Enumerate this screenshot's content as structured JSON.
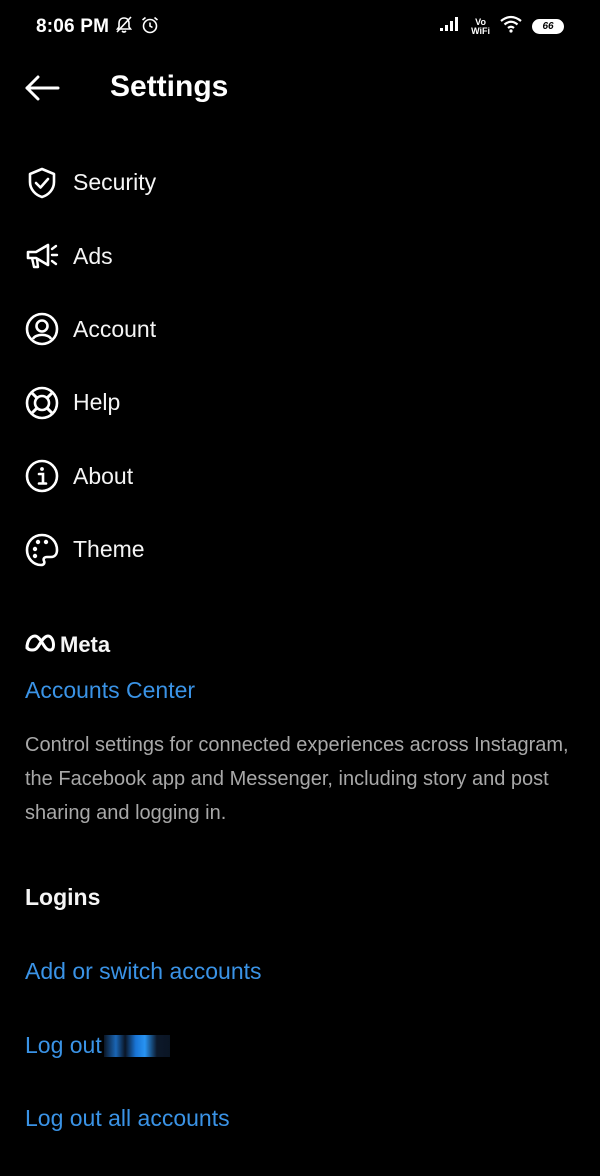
{
  "status_bar": {
    "time": "8:06 PM",
    "network_label_top": "Vo",
    "network_label_bottom": "WiFi",
    "battery": "66"
  },
  "header": {
    "title": "Settings"
  },
  "settings": {
    "items": [
      {
        "label": "Security",
        "icon": "shield-icon"
      },
      {
        "label": "Ads",
        "icon": "megaphone-icon"
      },
      {
        "label": "Account",
        "icon": "account-icon"
      },
      {
        "label": "Help",
        "icon": "lifebuoy-icon"
      },
      {
        "label": "About",
        "icon": "info-icon"
      },
      {
        "label": "Theme",
        "icon": "palette-icon"
      }
    ]
  },
  "meta": {
    "brand": "Meta",
    "accounts_center": "Accounts Center",
    "description": "Control settings for connected experiences across Instagram, the Facebook app and Messenger, including story and post sharing and logging in."
  },
  "logins": {
    "heading": "Logins",
    "add_switch": "Add or switch accounts",
    "log_out": "Log out",
    "log_out_all": "Log out all accounts"
  },
  "colors": {
    "background": "#000000",
    "text": "#f5f5f5",
    "link": "#3a93e6",
    "secondary_text": "#a8a8a8"
  }
}
